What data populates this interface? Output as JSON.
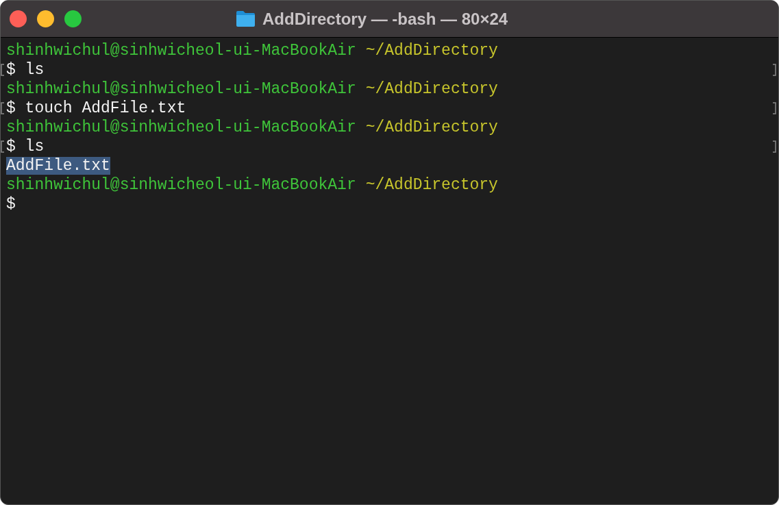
{
  "window": {
    "title": "AddDirectory — -bash — 80×24"
  },
  "lines": [
    {
      "kind": "prompt",
      "user_host": "shinhwichul@sinhwicheol-ui-MacBookAir",
      "path": "~/AddDirectory"
    },
    {
      "kind": "command",
      "text": "$ ls"
    },
    {
      "kind": "prompt",
      "user_host": "shinhwichul@sinhwicheol-ui-MacBookAir",
      "path": "~/AddDirectory"
    },
    {
      "kind": "command",
      "text": "$ touch AddFile.txt"
    },
    {
      "kind": "prompt",
      "user_host": "shinhwichul@sinhwicheol-ui-MacBookAir",
      "path": "~/AddDirectory"
    },
    {
      "kind": "command",
      "text": "$ ls"
    },
    {
      "kind": "output",
      "text": "AddFile.txt",
      "selected": true
    },
    {
      "kind": "prompt",
      "user_host": "shinhwichul@sinhwicheol-ui-MacBookAir",
      "path": "~/AddDirectory"
    },
    {
      "kind": "input",
      "text": "$"
    }
  ]
}
